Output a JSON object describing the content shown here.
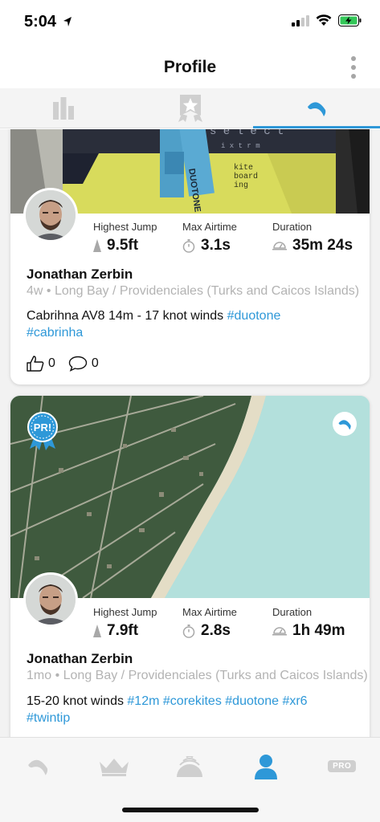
{
  "status_bar": {
    "time": "5:04"
  },
  "header": {
    "title": "Profile"
  },
  "tabs": [
    {
      "name": "stats",
      "icon": "bar-chart-icon",
      "active": false
    },
    {
      "name": "badges",
      "icon": "badge-star-icon",
      "active": false
    },
    {
      "name": "sessions",
      "icon": "kite-icon",
      "active": true
    }
  ],
  "photo_text": {
    "logo": "DUOTONE",
    "line1": "kite",
    "line2": "board",
    "line3": "ing"
  },
  "posts": [
    {
      "stats": [
        {
          "label": "Highest Jump",
          "value": "9.5ft",
          "icon": "jump-icon"
        },
        {
          "label": "Max Airtime",
          "value": "3.1s",
          "icon": "stopwatch-icon"
        },
        {
          "label": "Duration",
          "value": "35m 24s",
          "icon": "duration-icon"
        }
      ],
      "user": "Jonathan Zerbin",
      "meta": "4w • Long Bay / Providenciales (Turks and Caicos Islands)",
      "caption_text": "Cabrihna AV8 14m - 17 knot winds ",
      "hashtags": [
        "#duotone",
        "#cabrinha"
      ],
      "likes": "0",
      "comments": "0"
    },
    {
      "badge": "PR!",
      "stats": [
        {
          "label": "Highest Jump",
          "value": "7.9ft",
          "icon": "jump-icon"
        },
        {
          "label": "Max Airtime",
          "value": "2.8s",
          "icon": "stopwatch-icon"
        },
        {
          "label": "Duration",
          "value": "1h 49m",
          "icon": "duration-icon"
        }
      ],
      "user": "Jonathan Zerbin",
      "meta": "1mo • Long Bay / Providenciales (Turks and Caicos Islands)",
      "caption_text": "15-20 knot winds ",
      "hashtags": [
        "#12m",
        "#corekites",
        "#duotone",
        "#xr6",
        "#twintip"
      ]
    }
  ],
  "bottom_nav": [
    {
      "name": "sessions",
      "icon": "kite-icon",
      "active": false
    },
    {
      "name": "leaderboard",
      "icon": "crown-icon",
      "active": false
    },
    {
      "name": "live",
      "icon": "live-signal-icon",
      "active": false
    },
    {
      "name": "profile",
      "icon": "person-icon",
      "active": true
    },
    {
      "name": "pro",
      "label": "PRO",
      "active": false
    }
  ],
  "colors": {
    "accent": "#2e98d8",
    "inactive": "#cfcfcf",
    "meta_text": "#b3b3b3"
  }
}
